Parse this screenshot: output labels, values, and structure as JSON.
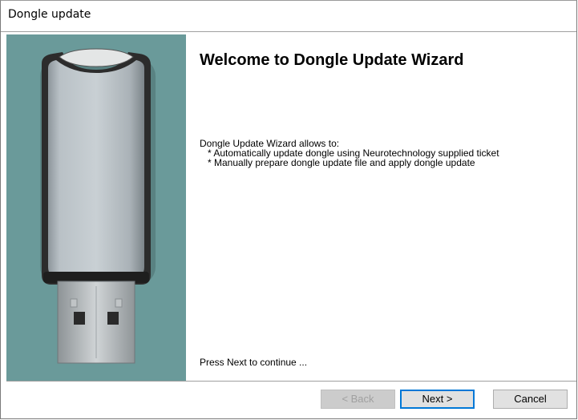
{
  "window": {
    "title": "Dongle update"
  },
  "side": {
    "image": "usb-dongle-illustration"
  },
  "main": {
    "heading": "Welcome to Dongle Update Wizard",
    "intro": "Dongle Update Wizard allows to:",
    "bullets": [
      "* Automatically update dongle using Neurotechnology supplied ticket",
      "* Manually prepare dongle update file and apply dongle update"
    ],
    "press_next": "Press Next to continue ..."
  },
  "buttons": {
    "back": "< Back",
    "next": "Next >",
    "cancel": "Cancel"
  },
  "colors": {
    "side_background": "#6a9a9a",
    "default_button_border": "#0078d7"
  }
}
